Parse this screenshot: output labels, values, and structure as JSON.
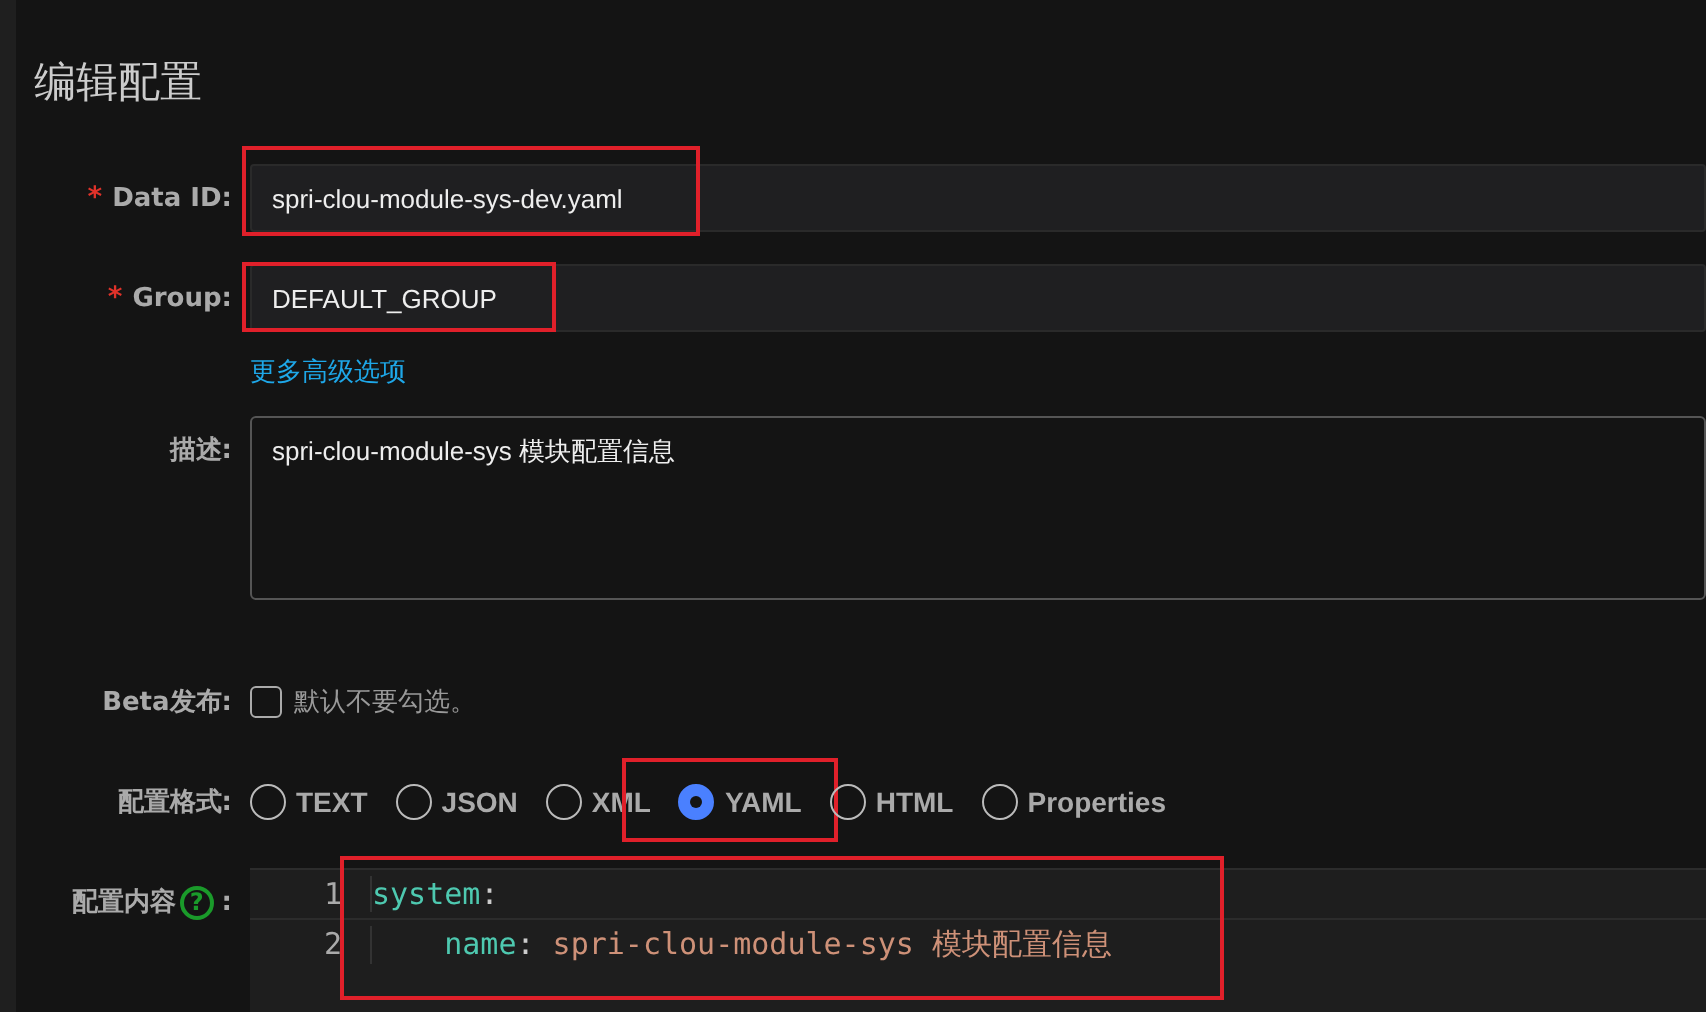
{
  "title": "编辑配置",
  "fields": [
    {
      "kind": "input",
      "required_mark": "*",
      "label": "Data ID:",
      "value": "spri-clou-module-sys-dev.yaml",
      "highlighted": true
    },
    {
      "kind": "input",
      "required_mark": "*",
      "label": "Group:",
      "value": "DEFAULT_GROUP",
      "highlighted": true
    },
    {
      "kind": "link",
      "text": "更多高级选项"
    },
    {
      "kind": "textarea",
      "label": "描述:",
      "value": "spri-clou-module-sys 模块配置信息",
      "highlighted": false
    },
    {
      "kind": "checkbox",
      "label": "Beta发布:",
      "text": "默认不要勾选。",
      "checked": false
    },
    {
      "kind": "radios",
      "label": "配置格式:",
      "options": [
        {
          "label": "TEXT",
          "selected": false,
          "highlighted": false
        },
        {
          "label": "JSON",
          "selected": false,
          "highlighted": false
        },
        {
          "label": "XML",
          "selected": false,
          "highlighted": false
        },
        {
          "label": "YAML",
          "selected": true,
          "highlighted": true
        },
        {
          "label": "HTML",
          "selected": false,
          "highlighted": false
        },
        {
          "label": "Properties",
          "selected": false,
          "highlighted": false
        }
      ]
    },
    {
      "kind": "editor",
      "label": "配置内容",
      "help": "?",
      "colon": ":",
      "highlighted": true,
      "lines": [
        {
          "number": "1",
          "key": "system",
          "sep": ":"
        },
        {
          "number": "2",
          "key": "    name",
          "sep": ":",
          "value": " spri-clou-module-sys 模块配置信息"
        }
      ]
    }
  ]
}
